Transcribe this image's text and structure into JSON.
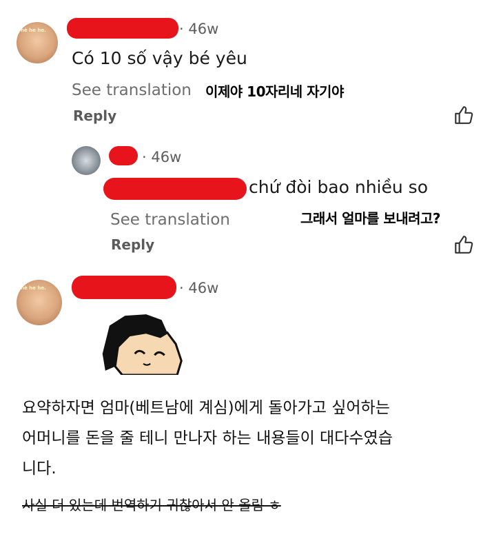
{
  "comment1": {
    "time": "· 46w",
    "text": "Có 10 số vậy bé yêu",
    "see_translation": "See translation",
    "korean_overlay": "이제야 10자리네 자기야",
    "reply": "Reply",
    "avatar_text": "hè he he."
  },
  "comment2": {
    "time": "· 46w",
    "text": "chứ đòi bao nhiều so",
    "see_translation": "See translation",
    "korean_overlay": "그래서 얼마를 보내려고?",
    "reply": "Reply"
  },
  "comment3": {
    "time": "· 46w",
    "avatar_text": "hè he he."
  },
  "summary": {
    "line1": "요약하자면 엄마(베트남에 계심)에게 돌아가고 싶어하는",
    "line2": "어머니를 돈을 줄 테니 만나자 하는 내용들이 대다수였습",
    "line3": "니다.",
    "strike": "사실 더 있는데 번역하기 귀찮아서 안 올림 ㅎ"
  },
  "icons": [
    "thumbs-up-icon",
    "avatar"
  ],
  "colors": {
    "redaction": "#e8141c",
    "muted": "#6e6e6e"
  }
}
